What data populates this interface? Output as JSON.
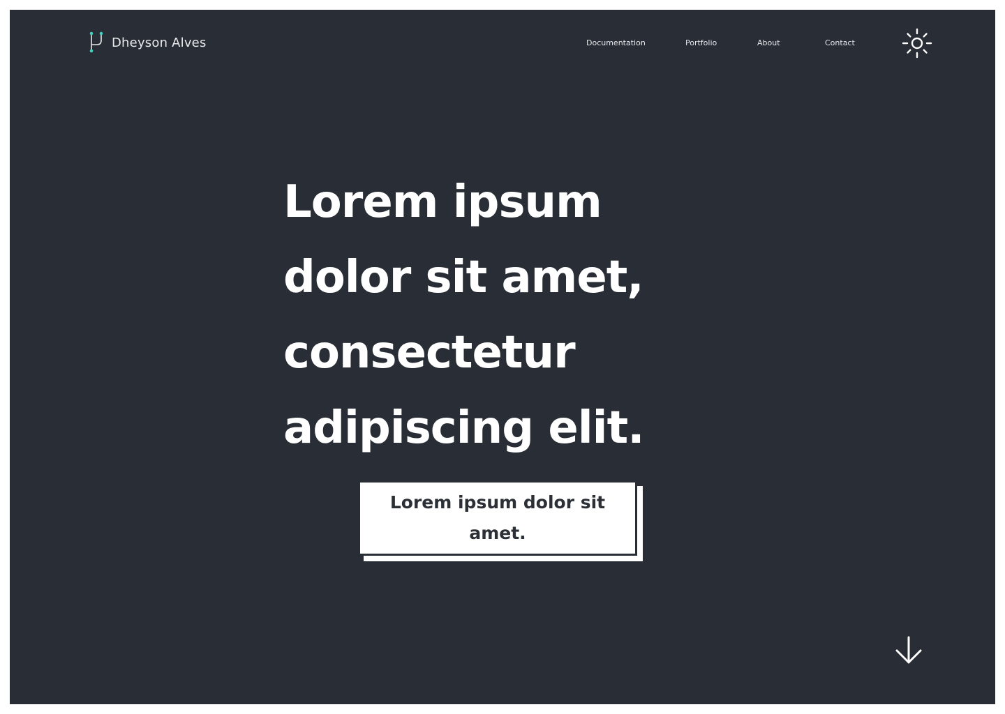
{
  "header": {
    "brand_name": "Dheyson Alves",
    "brand_icon": "git-branch-logo-icon",
    "nav": [
      {
        "label": "Documentation"
      },
      {
        "label": "Portfolio"
      },
      {
        "label": "About"
      },
      {
        "label": "Contact"
      }
    ],
    "theme_toggle_icon": "sun-icon"
  },
  "hero": {
    "lines": [
      "Lorem ipsum",
      "dolor sit amet,",
      "consectetur",
      "adipiscing elit."
    ],
    "cta_label": "Lorem ipsum dolor sit amet."
  },
  "scroll_icon": "arrow-down-icon",
  "colors": {
    "background": "#292d35",
    "text": "#ffffff",
    "accent": "#3fd0c0"
  }
}
